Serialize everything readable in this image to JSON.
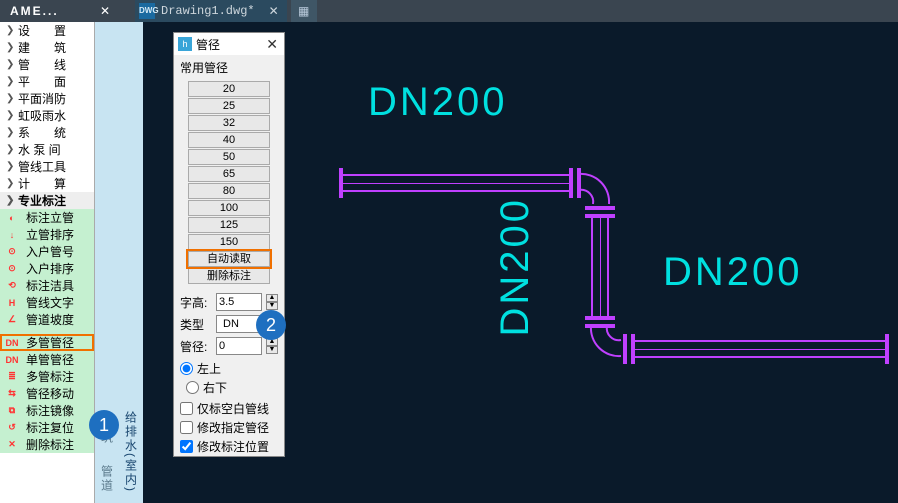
{
  "titlebar": {
    "ame": "AME...",
    "tab_label": "Drawing1.dwg*",
    "tab_icon": "DWG"
  },
  "side": {
    "groups": [
      {
        "items": [
          {
            "chev": "❯",
            "label": "设　　置",
            "wide": true,
            "heading": true
          },
          {
            "chev": "❯",
            "label": "建　　筑",
            "wide": true
          },
          {
            "chev": "❯",
            "label": "管　　线",
            "wide": true
          },
          {
            "chev": "❯",
            "label": "平　　面",
            "wide": true
          },
          {
            "chev": "❯",
            "label": "平面消防"
          },
          {
            "chev": "❯",
            "label": "虹吸雨水"
          },
          {
            "chev": "❯",
            "label": "系　　统",
            "wide": true
          },
          {
            "chev": "❯",
            "label": "水 泵 间"
          },
          {
            "chev": "❯",
            "label": "管线工具"
          },
          {
            "chev": "❯",
            "label": "计　　算",
            "wide": true
          }
        ]
      },
      {
        "bold": true,
        "items": [
          {
            "chev": "❯",
            "label": "专业标注"
          }
        ]
      },
      {
        "green": true,
        "items": [
          {
            "ico": "◐",
            "label": "标注立管"
          },
          {
            "ico": "↓",
            "label": "立管排序"
          },
          {
            "ico": "⊙",
            "label": "入户管号"
          },
          {
            "ico": "⊙",
            "label": "入户排序"
          },
          {
            "ico": "⟲",
            "label": "标注洁具"
          },
          {
            "ico": "H",
            "label": "管线文字"
          },
          {
            "ico": "∠",
            "label": "管道坡度"
          }
        ]
      },
      {
        "green": true,
        "items": [
          {
            "ico": "DN",
            "label": "多管管径",
            "hl": true
          },
          {
            "ico": "DN",
            "label": "单管管径"
          },
          {
            "ico": "≣",
            "label": "多管标注"
          },
          {
            "ico": "⇆",
            "label": "管径移动"
          },
          {
            "ico": "⧉",
            "label": "标注镜像"
          },
          {
            "ico": "↺",
            "label": "标注复位"
          },
          {
            "ico": "✕",
            "label": "删除标注"
          }
        ]
      }
    ]
  },
  "vstrips": [
    {
      "labels": [
        {
          "txt": "建筑",
          "dim": true
        },
        {
          "txt": "管道",
          "dim": true
        }
      ]
    },
    {
      "labels": [
        {
          "txt": "给排水(室内)",
          "dim": false
        }
      ]
    }
  ],
  "panel": {
    "title": "管径",
    "section": "常用管径",
    "dns": [
      "20",
      "25",
      "32",
      "40",
      "50",
      "65",
      "80",
      "100",
      "125",
      "150"
    ],
    "auto_read": "自动读取",
    "del_label": "删除标注",
    "zh": {
      "label": "字高:",
      "val": "3.5"
    },
    "type": {
      "label": "类型",
      "val": "DN"
    },
    "gj": {
      "label": "管径:",
      "val": "0"
    },
    "radios": {
      "l": "左上",
      "r": "右下"
    },
    "checks": [
      "仅标空白管线",
      "修改指定管径",
      "修改标注位置"
    ]
  },
  "canvas_text": {
    "dn1": "DN200",
    "dn2": "DN200",
    "dn3": "DN200"
  },
  "badges": {
    "b1": "1",
    "b2": "2"
  }
}
